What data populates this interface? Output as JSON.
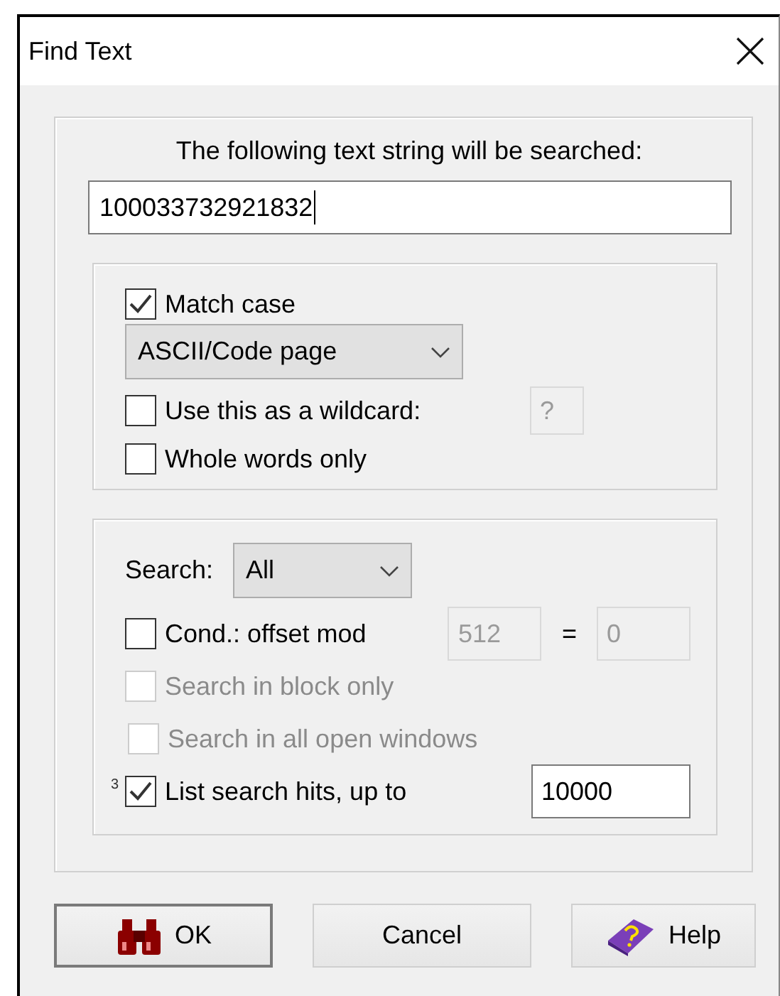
{
  "window": {
    "title": "Find Text"
  },
  "search_text": {
    "label": "The following text string will be searched:",
    "value": "100033732921832"
  },
  "options": [
    {
      "kind": "checkbox",
      "label": "Match case",
      "checked": true,
      "disabled": false
    },
    {
      "kind": "dropdown",
      "value": "ASCII/Code page"
    },
    {
      "kind": "checkbox",
      "label": "Use this as a wildcard:",
      "checked": false,
      "disabled": false,
      "field": "?",
      "field_disabled": true
    },
    {
      "kind": "checkbox",
      "label": "Whole words only",
      "checked": false,
      "disabled": false
    }
  ],
  "search_options": [
    {
      "kind": "dropdown",
      "label": "Search:",
      "value": "All"
    },
    {
      "kind": "checkbox",
      "label": "Cond.: offset mod",
      "checked": false,
      "disabled": false,
      "field": "512",
      "field_disabled": true,
      "equals": "=",
      "field_2": "0"
    },
    {
      "kind": "checkbox",
      "label": "Search in block only",
      "checked": false,
      "disabled": true
    },
    {
      "kind": "checkbox",
      "label": "Search in all open windows",
      "checked": false,
      "disabled": true
    },
    {
      "kind": "checkbox",
      "note": "3",
      "label": "List search hits, up to",
      "checked": true,
      "disabled": false,
      "field": "10000",
      "field_disabled": false
    }
  ],
  "buttons": [
    {
      "kind": "find",
      "label": "OK",
      "default": true
    },
    {
      "kind": "plain",
      "label": "Cancel",
      "default": false
    },
    {
      "kind": "help",
      "label": "Help",
      "default": false
    }
  ]
}
